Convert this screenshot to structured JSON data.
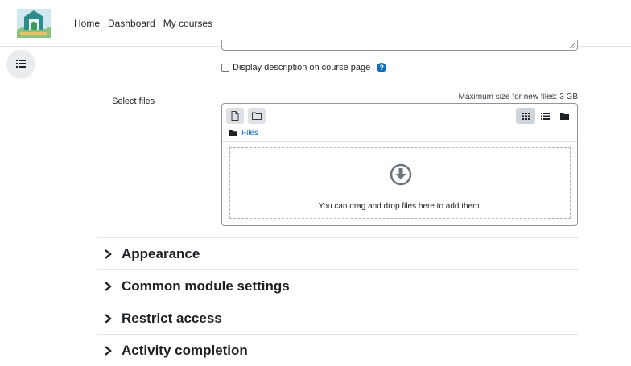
{
  "navbar": {
    "links": [
      "Home",
      "Dashboard",
      "My courses"
    ]
  },
  "form": {
    "display_description_label": "Display description on course page",
    "select_files_label": "Select files",
    "max_size_text": "Maximum size for new files: 3 GB",
    "filepicker": {
      "path_label": "Files",
      "drop_text": "You can drag and drop files here to add them."
    }
  },
  "sections": [
    {
      "title": "Appearance"
    },
    {
      "title": "Common module settings"
    },
    {
      "title": "Restrict access"
    },
    {
      "title": "Activity completion"
    }
  ],
  "colors": {
    "accent": "#0f6cbf",
    "text": "#1d2125",
    "border": "#8f959e"
  },
  "icons": {
    "drawer": "list-icon",
    "help": "question-circle-icon",
    "add_file": "file-icon",
    "new_folder": "folder-outline-icon",
    "view_icons": "grid-icon",
    "view_list": "list-icon",
    "view_tree": "folder-icon",
    "drop": "download-circle-icon",
    "section_toggle": "chevron-right-icon"
  }
}
